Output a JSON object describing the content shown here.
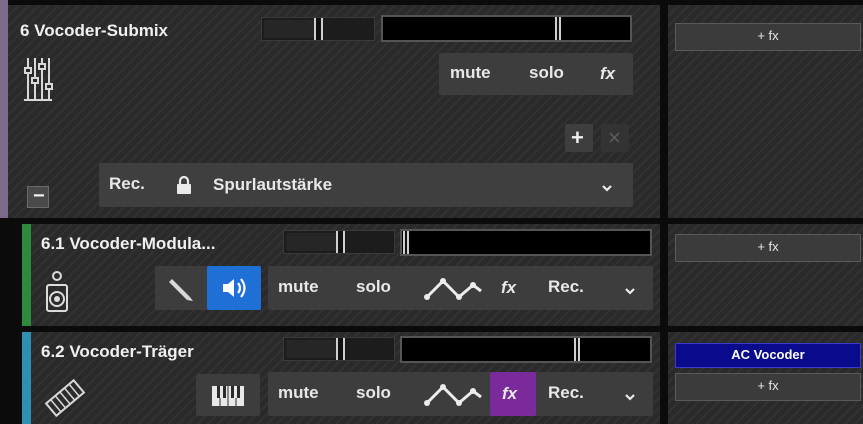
{
  "tracks": [
    {
      "name": "6 Vocoder-Submix",
      "mute_label": "mute",
      "solo_label": "solo",
      "fx_label": "fx",
      "color": "#7b6a8a",
      "add_fx_label": "+ fx",
      "automation": {
        "rec_label": "Rec.",
        "parameter": "Spurlautstärke"
      },
      "add_label": "+",
      "remove_label": "×",
      "collapse_label": "−"
    },
    {
      "name": "6.1 Vocoder-Modula...",
      "mute_label": "mute",
      "solo_label": "solo",
      "fx_label": "fx",
      "rec_label": "Rec.",
      "color": "#2e8b3e",
      "speaker_color": "#1e6fd6",
      "add_fx_label": "+ fx"
    },
    {
      "name": "6.2 Vocoder-Träger",
      "mute_label": "mute",
      "solo_label": "solo",
      "fx_label": "fx",
      "rec_label": "Rec.",
      "color": "#2f8fb0",
      "fx_active_color": "#7a2a9a",
      "plugin": "AC Vocoder",
      "add_fx_label": "+ fx"
    }
  ]
}
